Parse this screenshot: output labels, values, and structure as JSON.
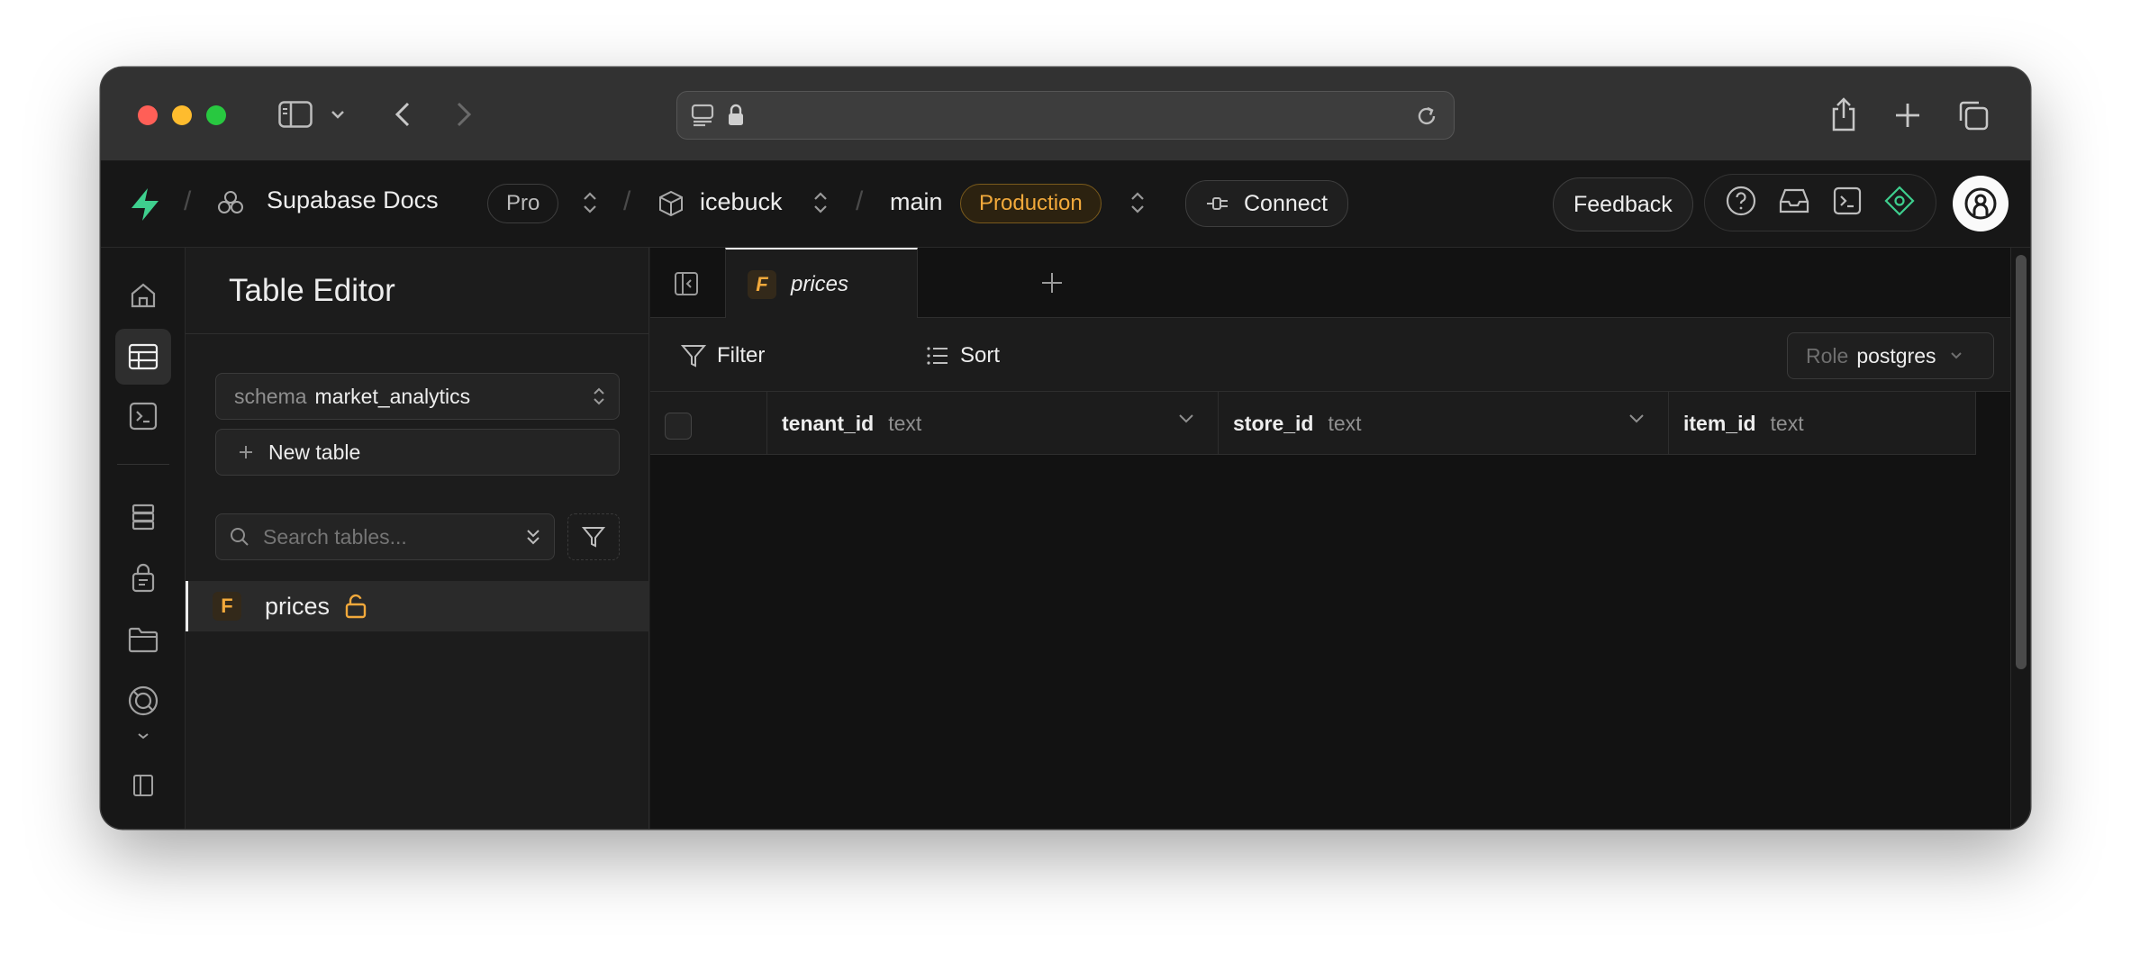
{
  "browser": {
    "address_text": ""
  },
  "header": {
    "org_name": "Supabase Docs",
    "plan_badge": "Pro",
    "project_name": "icebuck",
    "branch_name": "main",
    "environment_badge": "Production",
    "connect_label": "Connect",
    "feedback_label": "Feedback"
  },
  "rail": {
    "items": [
      "home",
      "table-editor",
      "sql-editor",
      "database",
      "authentication",
      "storage",
      "realtime",
      "more"
    ],
    "active": "table-editor"
  },
  "sidebar": {
    "title": "Table Editor",
    "schema_prefix": "schema",
    "schema_value": "market_analytics",
    "new_table_label": "New table",
    "search_placeholder": "Search tables...",
    "tables": [
      {
        "badge": "F",
        "name": "prices",
        "lock_state": "unlocked"
      }
    ]
  },
  "main": {
    "tabs": [
      {
        "badge": "F",
        "label": "prices",
        "active": true
      }
    ],
    "toolbar": {
      "filter_label": "Filter",
      "sort_label": "Sort",
      "role_prefix": "Role",
      "role_value": "postgres"
    },
    "columns": [
      {
        "name": "tenant_id",
        "type": "text"
      },
      {
        "name": "store_id",
        "type": "text"
      },
      {
        "name": "item_id",
        "type": "text"
      }
    ]
  },
  "colors": {
    "brand_green": "#3ecf8e",
    "production_amber": "#f2a93b",
    "background": "#1c1c1c"
  }
}
